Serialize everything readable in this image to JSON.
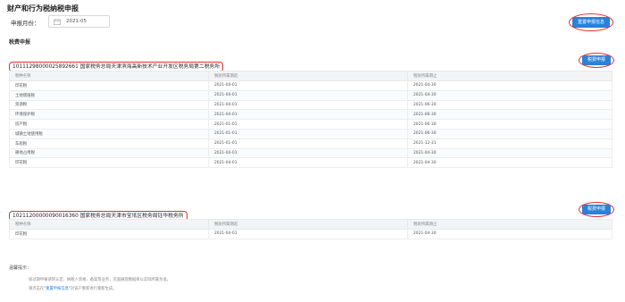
{
  "page": {
    "title": "财产和行为税纳税申报"
  },
  "filter": {
    "period_label": "申报月份：",
    "period_value": "2021-05"
  },
  "redeclare_button": "重置申报信息",
  "section_title": "税费申报",
  "table_headers": {
    "tax_type": "税种名称",
    "period_start": "税款所属期起",
    "period_end": "税款所属期止"
  },
  "declare_label": "税费申报",
  "offices": [
    {
      "text": "10111298000025892661 国家税务总局天津滨海高新技术产业开发区税务局第二税务所",
      "rows": [
        {
          "name": "印花税",
          "start": "2021-04-01",
          "end": "2021-04-30"
        },
        {
          "name": "土地增值税",
          "start": "2021-04-01",
          "end": "2021-04-30"
        },
        {
          "name": "资源税",
          "start": "2021-04-01",
          "end": "2021-06-30"
        },
        {
          "name": "环境保护税",
          "start": "2021-04-01",
          "end": "2021-06-30"
        },
        {
          "name": "房产税",
          "start": "2021-01-01",
          "end": "2021-06-30"
        },
        {
          "name": "城镇土地使用税",
          "start": "2021-01-01",
          "end": "2021-06-30"
        },
        {
          "name": "车船税",
          "start": "2021-01-01",
          "end": "2021-12-31"
        },
        {
          "name": "耕地占用税",
          "start": "2021-04-01",
          "end": "2021-04-30"
        },
        {
          "name": "印花税",
          "start": "2021-04-01",
          "end": "2021-04-30"
        }
      ]
    },
    {
      "text": "10211200000090016360 国家税务总局天津市宝坻区税务局钰华税务所",
      "rows": [
        {
          "name": "印花税",
          "start": "2021-04-01",
          "end": "2021-04-30"
        }
      ]
    }
  ],
  "tips": {
    "title": "温馨提示：",
    "line1": "如过期申报请到认定、纳税人资格、备案等业务，页面展现数据将以实际所属为准。",
    "line2_prefix": "请点击在",
    "line2_link": "\"重置申报信息\"",
    "line2_suffix": "对该户重新进行重新生成。"
  },
  "colors": {
    "primary": "#2a82d8",
    "highlight": "#e03131"
  }
}
